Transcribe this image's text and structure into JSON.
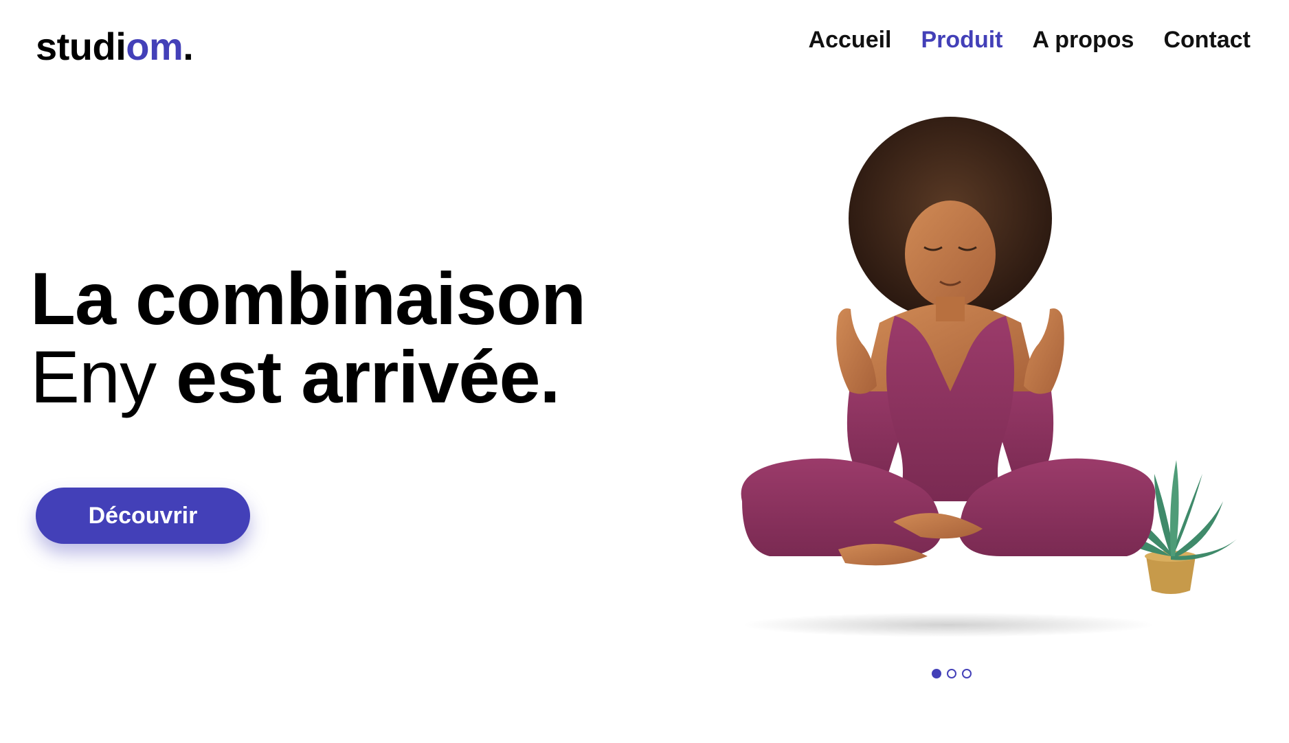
{
  "logo": {
    "text_main": "studi",
    "text_accent": "om",
    "text_dot": "."
  },
  "nav": {
    "items": [
      {
        "label": "Accueil",
        "active": false
      },
      {
        "label": "Produit",
        "active": true
      },
      {
        "label": "A propos",
        "active": false
      },
      {
        "label": "Contact",
        "active": false
      }
    ]
  },
  "hero": {
    "line1": "La combinaison",
    "line2_light": "Eny",
    "line2_bold": "est arrivée."
  },
  "cta": {
    "label": "Découvrir"
  },
  "carousel": {
    "count": 3,
    "active_index": 0
  },
  "colors": {
    "accent": "#4340b8",
    "suit": "#8a2f5c",
    "skin": "#b87345",
    "hair": "#3a2417"
  }
}
